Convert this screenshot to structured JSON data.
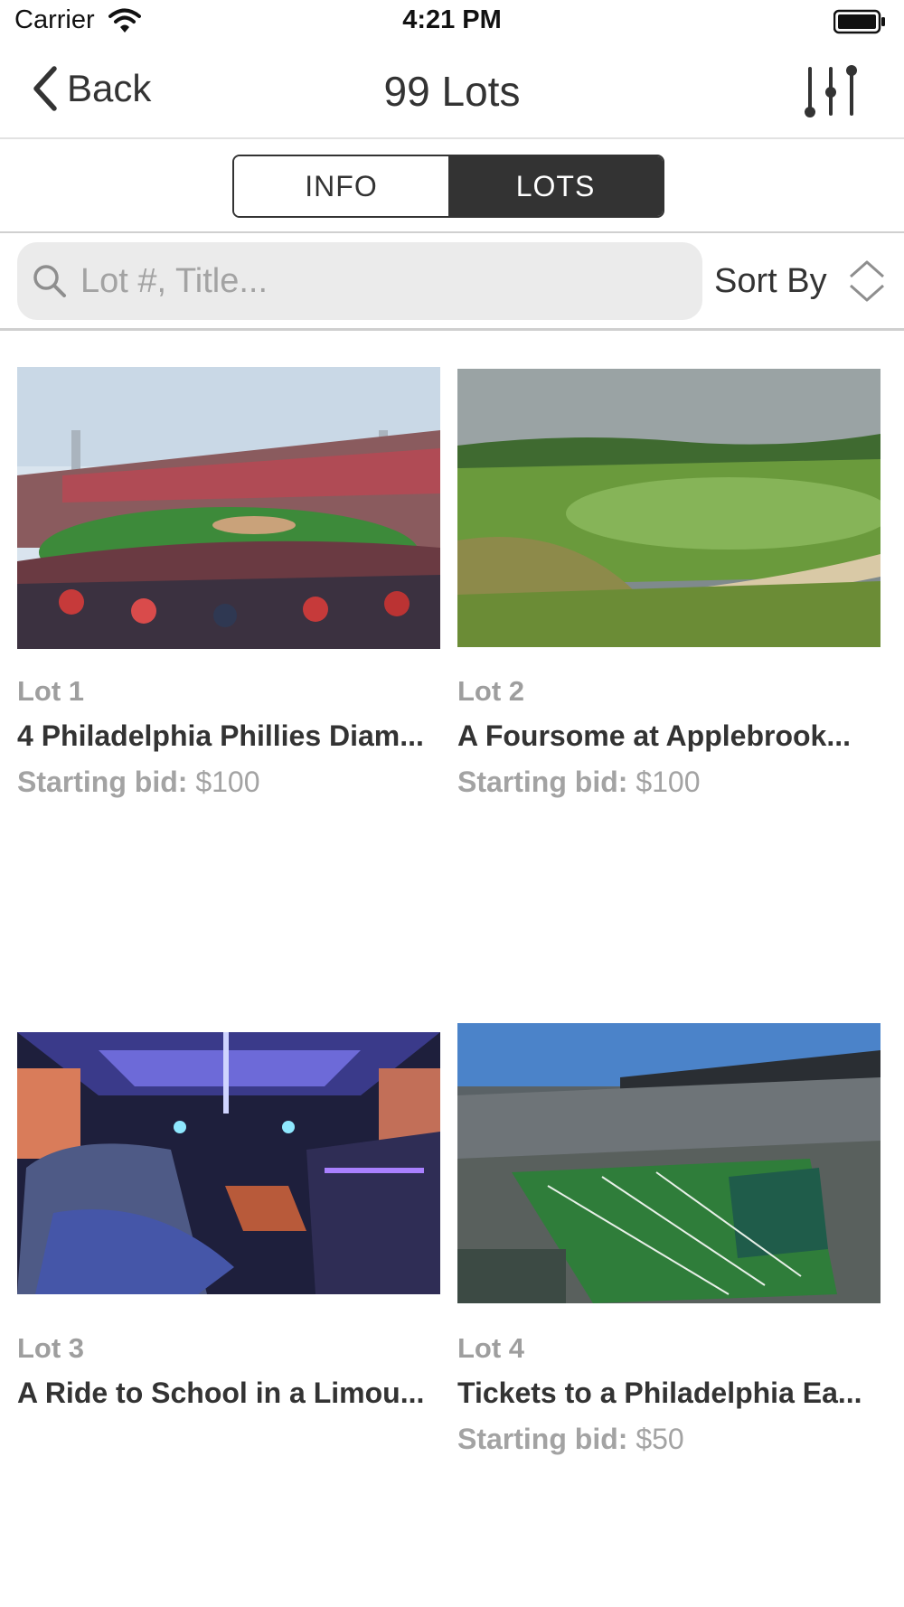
{
  "status_bar": {
    "carrier": "Carrier",
    "time": "4:21 PM",
    "icons": [
      "wifi-icon",
      "battery-icon"
    ]
  },
  "nav": {
    "back_label": "Back",
    "title": "99 Lots",
    "icons": [
      "chevron-left-icon",
      "filter-sliders-icon"
    ]
  },
  "segments": {
    "info": "INFO",
    "lots": "LOTS",
    "selected": "LOTS"
  },
  "search": {
    "placeholder": "Lot #, Title...",
    "value": "",
    "sort_label": "Sort By",
    "icons": [
      "search-icon",
      "sort-updown-icon"
    ]
  },
  "lots": [
    {
      "number": "Lot 1",
      "title": "4 Philadelphia Phillies Diam...",
      "bid_label": "Starting bid:",
      "bid_value": "$100",
      "image": "baseball-stadium-photo"
    },
    {
      "number": "Lot 2",
      "title": "A Foursome at Applebrook...",
      "bid_label": "Starting bid:",
      "bid_value": "$100",
      "image": "golf-course-photo"
    },
    {
      "number": "Lot 3",
      "title": "A Ride to School in a Limou...",
      "bid_label": "",
      "bid_value": "",
      "image": "limousine-interior-photo"
    },
    {
      "number": "Lot 4",
      "title": "Tickets to a Philadelphia Ea...",
      "bid_label": "Starting bid:",
      "bid_value": "$50",
      "image": "football-stadium-photo"
    }
  ],
  "colors": {
    "accent_dark": "#333333",
    "muted_text": "#a3a3a3",
    "search_bg": "#ebebeb"
  }
}
